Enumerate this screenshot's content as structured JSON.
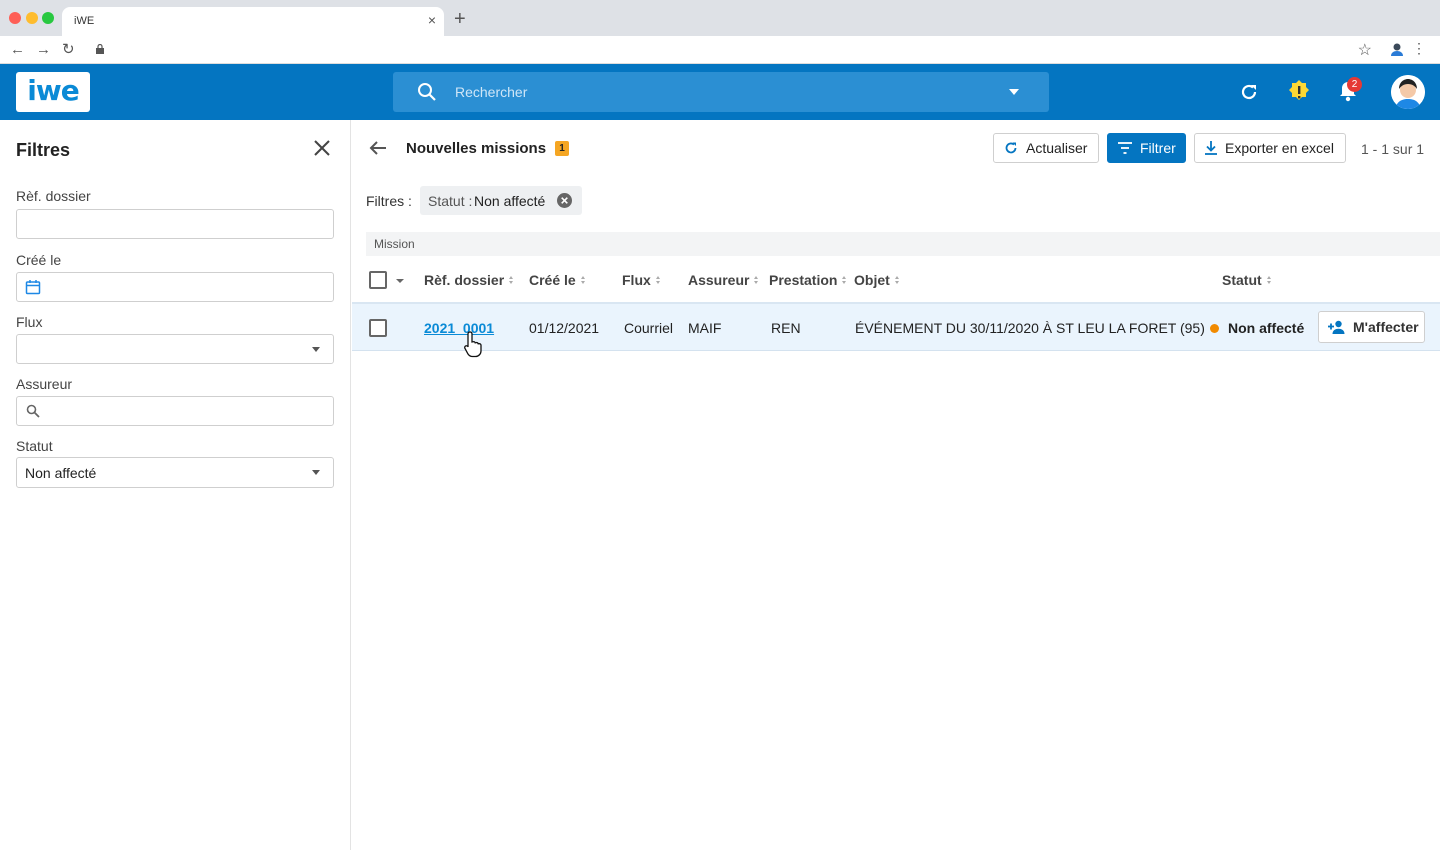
{
  "browser": {
    "tab_title": "iWE",
    "tab_close": "×",
    "new_tab": "+"
  },
  "header": {
    "logo": "iwe",
    "search_placeholder": "Rechercher",
    "notification_count": "2",
    "colors": {
      "brand": "#0475c1",
      "alert": "#fdd835",
      "badge": "#e53935"
    }
  },
  "sidebar": {
    "title": "Filtres",
    "fields": [
      {
        "label": "Rèf. dossier",
        "value": ""
      },
      {
        "label": "Créé le",
        "value": ""
      },
      {
        "label": "Flux",
        "value": ""
      },
      {
        "label": "Assureur",
        "value": ""
      },
      {
        "label": "Statut",
        "value": "Non affecté"
      }
    ]
  },
  "main": {
    "title": "Nouvelles missions",
    "title_badge": "1",
    "toolbar": {
      "refresh_label": "Actualiser",
      "filter_label": "Filtrer",
      "export_label": "Exporter en excel"
    },
    "pagination": "1 - 1 sur 1",
    "filters_label": "Filtres :",
    "active_filter": {
      "key": "Statut :",
      "value": "Non affecté"
    },
    "section_label": "Mission",
    "columns": [
      "Rèf. dossier",
      "Créé le",
      "Flux",
      "Assureur",
      "Prestation",
      "Objet",
      "Statut"
    ],
    "rows": [
      {
        "ref": "2021_0001",
        "created": "01/12/2021",
        "flux": "Courriel",
        "assureur": "MAIF",
        "prestation": "REN",
        "objet": "ÉVÉNEMENT DU 30/11/2020 À ST LEU LA FORET (95)",
        "statut": "Non affecté",
        "status_color": "#f18a00",
        "action_label": "M'affecter"
      }
    ]
  }
}
